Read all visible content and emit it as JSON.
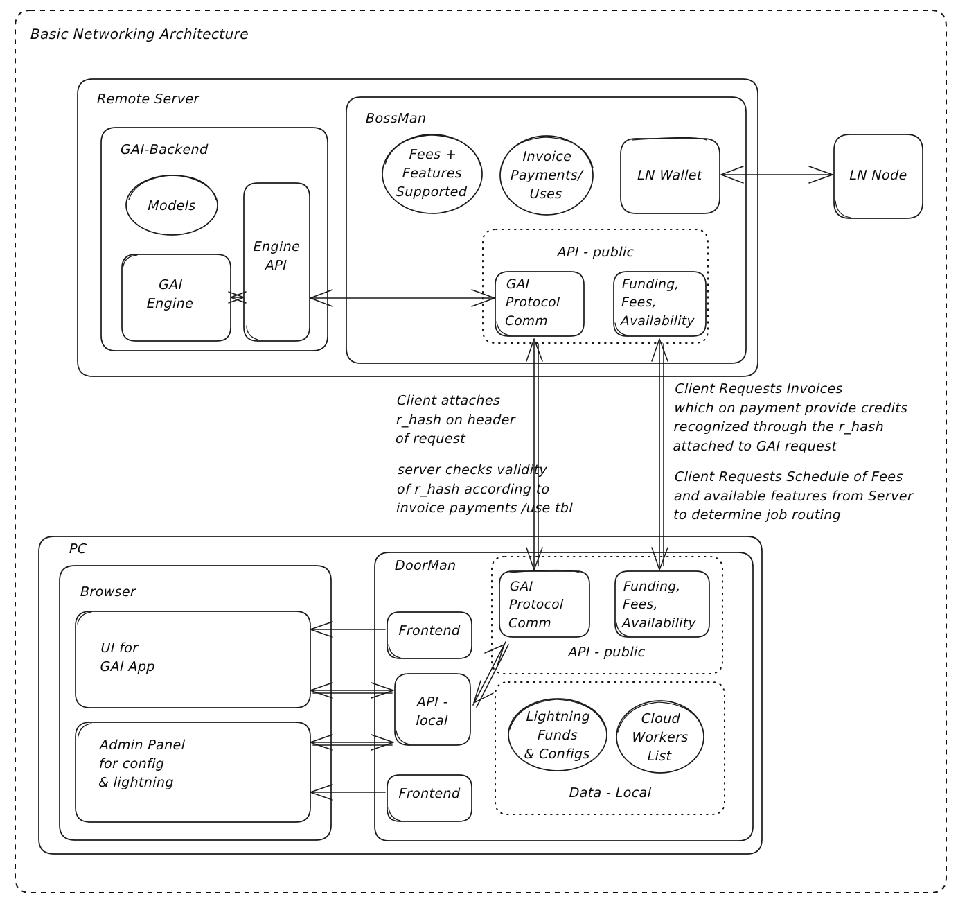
{
  "title": "Basic Networking Architecture",
  "groups": {
    "remote_server": "Remote Server",
    "bossman": "BossMan",
    "gai_backend": "GAI-Backend",
    "api_public_server": "API - public",
    "pc": "PC",
    "browser": "Browser",
    "doorman": "DoorMan",
    "api_public_client": "API - public",
    "data_local": "Data - Local"
  },
  "nodes": {
    "models": "Models",
    "gai_engine": "GAI\nEngine",
    "engine_api": "Engine\nAPI",
    "fees_features": "Fees +\nFeatures\nSupported",
    "invoice_payments": "Invoice\nPayments/\nUses",
    "ln_wallet": "LN Wallet",
    "ln_node": "LN Node",
    "gai_protocol_comm_server": "GAI\nProtocol\nComm",
    "funding_fees_availability_server": "Funding,\nFees,\nAvailability",
    "ui_for_gai_app": "UI for\nGAI App",
    "admin_panel": "Admin Panel\nfor config\n& lightning",
    "frontend_top": "Frontend",
    "frontend_bottom": "Frontend",
    "api_local": "API -\nlocal",
    "gai_protocol_comm_client": "GAI\nProtocol\nComm",
    "funding_fees_availability_client": "Funding,\nFees,\nAvailability",
    "lightning_funds": "Lightning\nFunds\n& Configs",
    "cloud_workers": "Cloud\nWorkers\nList"
  },
  "annotations": {
    "left_note_1": "Client attaches\nr_hash on header\nof request",
    "left_note_2": "server checks validity\nof r_hash according to\ninvoice payments /use tbl",
    "right_note_1": "Client Requests Invoices\nwhich on payment provide credits\nrecognized through the r_hash\nattached to GAI request",
    "right_note_2": "Client Requests Schedule of Fees\nand available features from Server\nto determine job routing"
  },
  "colors": {
    "stroke": "#1a1a1a",
    "background": "#ffffff",
    "text": "#0a0a0a"
  }
}
